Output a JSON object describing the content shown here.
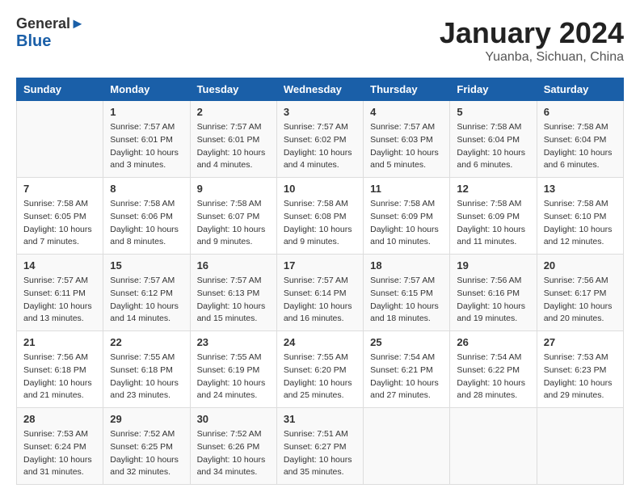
{
  "header": {
    "logo_general": "General",
    "logo_blue": "Blue",
    "month_title": "January 2024",
    "location": "Yuanba, Sichuan, China"
  },
  "columns": [
    "Sunday",
    "Monday",
    "Tuesday",
    "Wednesday",
    "Thursday",
    "Friday",
    "Saturday"
  ],
  "weeks": [
    [
      {
        "day": "",
        "sunrise": "",
        "sunset": "",
        "daylight": ""
      },
      {
        "day": "1",
        "sunrise": "Sunrise: 7:57 AM",
        "sunset": "Sunset: 6:01 PM",
        "daylight": "Daylight: 10 hours and 3 minutes."
      },
      {
        "day": "2",
        "sunrise": "Sunrise: 7:57 AM",
        "sunset": "Sunset: 6:01 PM",
        "daylight": "Daylight: 10 hours and 4 minutes."
      },
      {
        "day": "3",
        "sunrise": "Sunrise: 7:57 AM",
        "sunset": "Sunset: 6:02 PM",
        "daylight": "Daylight: 10 hours and 4 minutes."
      },
      {
        "day": "4",
        "sunrise": "Sunrise: 7:57 AM",
        "sunset": "Sunset: 6:03 PM",
        "daylight": "Daylight: 10 hours and 5 minutes."
      },
      {
        "day": "5",
        "sunrise": "Sunrise: 7:58 AM",
        "sunset": "Sunset: 6:04 PM",
        "daylight": "Daylight: 10 hours and 6 minutes."
      },
      {
        "day": "6",
        "sunrise": "Sunrise: 7:58 AM",
        "sunset": "Sunset: 6:04 PM",
        "daylight": "Daylight: 10 hours and 6 minutes."
      }
    ],
    [
      {
        "day": "7",
        "sunrise": "Sunrise: 7:58 AM",
        "sunset": "Sunset: 6:05 PM",
        "daylight": "Daylight: 10 hours and 7 minutes."
      },
      {
        "day": "8",
        "sunrise": "Sunrise: 7:58 AM",
        "sunset": "Sunset: 6:06 PM",
        "daylight": "Daylight: 10 hours and 8 minutes."
      },
      {
        "day": "9",
        "sunrise": "Sunrise: 7:58 AM",
        "sunset": "Sunset: 6:07 PM",
        "daylight": "Daylight: 10 hours and 9 minutes."
      },
      {
        "day": "10",
        "sunrise": "Sunrise: 7:58 AM",
        "sunset": "Sunset: 6:08 PM",
        "daylight": "Daylight: 10 hours and 9 minutes."
      },
      {
        "day": "11",
        "sunrise": "Sunrise: 7:58 AM",
        "sunset": "Sunset: 6:09 PM",
        "daylight": "Daylight: 10 hours and 10 minutes."
      },
      {
        "day": "12",
        "sunrise": "Sunrise: 7:58 AM",
        "sunset": "Sunset: 6:09 PM",
        "daylight": "Daylight: 10 hours and 11 minutes."
      },
      {
        "day": "13",
        "sunrise": "Sunrise: 7:58 AM",
        "sunset": "Sunset: 6:10 PM",
        "daylight": "Daylight: 10 hours and 12 minutes."
      }
    ],
    [
      {
        "day": "14",
        "sunrise": "Sunrise: 7:57 AM",
        "sunset": "Sunset: 6:11 PM",
        "daylight": "Daylight: 10 hours and 13 minutes."
      },
      {
        "day": "15",
        "sunrise": "Sunrise: 7:57 AM",
        "sunset": "Sunset: 6:12 PM",
        "daylight": "Daylight: 10 hours and 14 minutes."
      },
      {
        "day": "16",
        "sunrise": "Sunrise: 7:57 AM",
        "sunset": "Sunset: 6:13 PM",
        "daylight": "Daylight: 10 hours and 15 minutes."
      },
      {
        "day": "17",
        "sunrise": "Sunrise: 7:57 AM",
        "sunset": "Sunset: 6:14 PM",
        "daylight": "Daylight: 10 hours and 16 minutes."
      },
      {
        "day": "18",
        "sunrise": "Sunrise: 7:57 AM",
        "sunset": "Sunset: 6:15 PM",
        "daylight": "Daylight: 10 hours and 18 minutes."
      },
      {
        "day": "19",
        "sunrise": "Sunrise: 7:56 AM",
        "sunset": "Sunset: 6:16 PM",
        "daylight": "Daylight: 10 hours and 19 minutes."
      },
      {
        "day": "20",
        "sunrise": "Sunrise: 7:56 AM",
        "sunset": "Sunset: 6:17 PM",
        "daylight": "Daylight: 10 hours and 20 minutes."
      }
    ],
    [
      {
        "day": "21",
        "sunrise": "Sunrise: 7:56 AM",
        "sunset": "Sunset: 6:18 PM",
        "daylight": "Daylight: 10 hours and 21 minutes."
      },
      {
        "day": "22",
        "sunrise": "Sunrise: 7:55 AM",
        "sunset": "Sunset: 6:18 PM",
        "daylight": "Daylight: 10 hours and 23 minutes."
      },
      {
        "day": "23",
        "sunrise": "Sunrise: 7:55 AM",
        "sunset": "Sunset: 6:19 PM",
        "daylight": "Daylight: 10 hours and 24 minutes."
      },
      {
        "day": "24",
        "sunrise": "Sunrise: 7:55 AM",
        "sunset": "Sunset: 6:20 PM",
        "daylight": "Daylight: 10 hours and 25 minutes."
      },
      {
        "day": "25",
        "sunrise": "Sunrise: 7:54 AM",
        "sunset": "Sunset: 6:21 PM",
        "daylight": "Daylight: 10 hours and 27 minutes."
      },
      {
        "day": "26",
        "sunrise": "Sunrise: 7:54 AM",
        "sunset": "Sunset: 6:22 PM",
        "daylight": "Daylight: 10 hours and 28 minutes."
      },
      {
        "day": "27",
        "sunrise": "Sunrise: 7:53 AM",
        "sunset": "Sunset: 6:23 PM",
        "daylight": "Daylight: 10 hours and 29 minutes."
      }
    ],
    [
      {
        "day": "28",
        "sunrise": "Sunrise: 7:53 AM",
        "sunset": "Sunset: 6:24 PM",
        "daylight": "Daylight: 10 hours and 31 minutes."
      },
      {
        "day": "29",
        "sunrise": "Sunrise: 7:52 AM",
        "sunset": "Sunset: 6:25 PM",
        "daylight": "Daylight: 10 hours and 32 minutes."
      },
      {
        "day": "30",
        "sunrise": "Sunrise: 7:52 AM",
        "sunset": "Sunset: 6:26 PM",
        "daylight": "Daylight: 10 hours and 34 minutes."
      },
      {
        "day": "31",
        "sunrise": "Sunrise: 7:51 AM",
        "sunset": "Sunset: 6:27 PM",
        "daylight": "Daylight: 10 hours and 35 minutes."
      },
      {
        "day": "",
        "sunrise": "",
        "sunset": "",
        "daylight": ""
      },
      {
        "day": "",
        "sunrise": "",
        "sunset": "",
        "daylight": ""
      },
      {
        "day": "",
        "sunrise": "",
        "sunset": "",
        "daylight": ""
      }
    ]
  ]
}
